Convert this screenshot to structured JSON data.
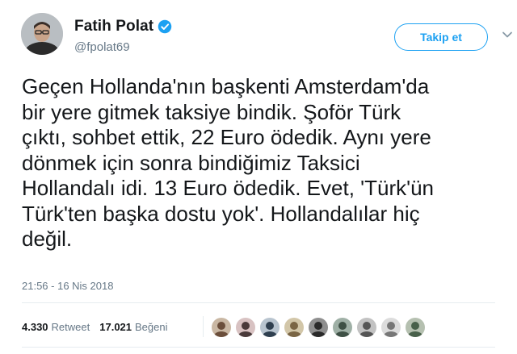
{
  "author": {
    "name": "Fatih Polat",
    "handle": "@fpolat69",
    "verified_icon": "verified-badge-icon"
  },
  "actions": {
    "follow_label": "Takip et",
    "menu_icon": "chevron-down-icon"
  },
  "tweet": {
    "lines": [
      "Geçen Hollanda'nın başkenti Amsterdam'da",
      "bir yere gitmek taksiye bindik. Şoför Türk",
      "çıktı, sohbet ettik, 22 Euro ödedik. Aynı yere",
      "dönmek için sonra bindiğimiz Taksici",
      "Hollandalı idi. 13 Euro ödedik. Evet, 'Türk'ün",
      "Türk'ten başka dostu yok'. Hollandalılar hiç",
      "değil."
    ],
    "timestamp": "21:56 - 16 Nis 2018"
  },
  "stats": {
    "retweets": {
      "count": "4.330",
      "label": "Retweet"
    },
    "likes": {
      "count": "17.021",
      "label": "Beğeni"
    }
  },
  "likers": {
    "count": 9,
    "icon": "user-avatar-icon"
  },
  "colors": {
    "accent": "#1da1f2",
    "text": "#14171a",
    "muted": "#657786",
    "divider": "#e6ecf0"
  }
}
